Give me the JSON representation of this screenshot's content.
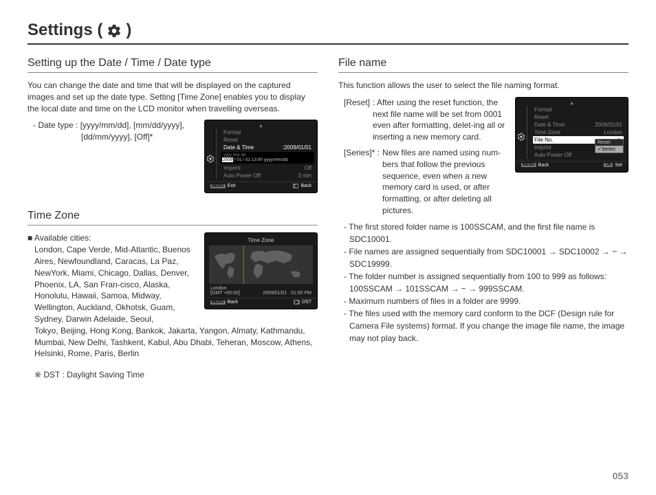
{
  "page": {
    "title_prefix": "Settings (",
    "title_suffix": ")",
    "number": "053"
  },
  "left": {
    "section1": {
      "heading": "Setting up the Date / Time / Date type",
      "intro": "You can change the date and time that will be displayed on the captured images and set up the date type. Setting [Time Zone] enables you to display the local date and time on the LCD monitor when travelling overseas.",
      "datetype_line1": "- Date type : [yyyy/mm/dd], [mm/dd/yyyy],",
      "datetype_line2": "[dd/mm/yyyy], [Off]*"
    },
    "section2": {
      "heading": "Time Zone",
      "avail_label": "Available cities:",
      "cities_part1": "London, Cape Verde, Mid-Atlantic, Buenos Aires, Newfoundland, Caracas, La Paz, NewYork, Miami, Chicago, Dallas, Denver, Phoenix, LA, San Fran-cisco, Alaska, Honolulu, Hawaii, Samoa, Midway, Wellington, Auckland, Okhotsk, Guam, Sydney, Darwin Adelaide, Seoul,",
      "cities_part2": "Tokyo, Beijing, Hong Kong, Bankok, Jakarta, Yangon, Almaty, Kathmandu, Mumbai, New Delhi, Tashkent, Kabul, Abu Dhabi, Teheran, Moscow, Athens, Helsinki, Rome, Paris, Berlin",
      "dst_note": "※ DST : Daylight Saving Time"
    }
  },
  "right": {
    "heading": "File name",
    "intro": "This function allows the user to select the file naming format.",
    "reset_label": "[Reset]",
    "reset_text": ": After using the reset function, the next file name will be set from 0001 even after formatting, delet-ing all or inserting a new memory card.",
    "series_label": "[Series]* :",
    "series_text": "New files are named using num-bers that follow the previous sequence, even when a new memory card is used, or after formatting, or after deleting all pictures.",
    "note1": "- The first stored folder name is 100SSCAM, and the first file name is SDC10001.",
    "note2": "- File names are assigned sequentially from SDC10001 → SDC10002 → ~ → SDC19999.",
    "note3": "- The folder number is assigned sequentially from 100 to 999 as follows: 100SSCAM → 101SSCAM → ~ → 999SSCAM.",
    "note4": "- Maximum numbers of files in a folder are 9999.",
    "note5": "- The files used with the memory card conform to the DCF (Design rule for Camera File systems) format. If you change the image file name, the image may not play back."
  },
  "ss_date": {
    "format": "Format",
    "reset": "Reset",
    "date_time": "Date & Time",
    "date_time_val": ":2009/01/01",
    "editor_hint": "yyyy  mm  dd",
    "editor_val_left": "2009",
    "editor_val_right": "/ 01 / 01   13:00    yyyy/mm/dd",
    "imprint": "Imprint",
    "imprint_val": "Off",
    "apo": "Auto Power Off",
    "apo_val": "3 min",
    "exit_badge": "MENU",
    "exit": "Exit",
    "back_badge": "◀",
    "back": "Back"
  },
  "ss_tz": {
    "title": "Time Zone",
    "city": "London",
    "gmt": "[GMT +00:00]",
    "date": "2009/01/01",
    "time": "01:00 PM",
    "back_badge": "MENU",
    "back": "Back",
    "dst_badge": "▶",
    "dst": "DST"
  },
  "ss_fn": {
    "format": "Format",
    "reset": "Reset",
    "date_time": "Date & Time",
    "date_time_val": "2009/01/01",
    "time_zone": "Time Zone",
    "time_zone_val": "London",
    "file_no": "File No.",
    "imprint": "Imprint",
    "apo": "Auto Power Off",
    "popup_reset": "Reset",
    "popup_series": "Series",
    "back_badge": "MENU",
    "back": "Back",
    "set_badge": "OK",
    "set": "Set"
  }
}
